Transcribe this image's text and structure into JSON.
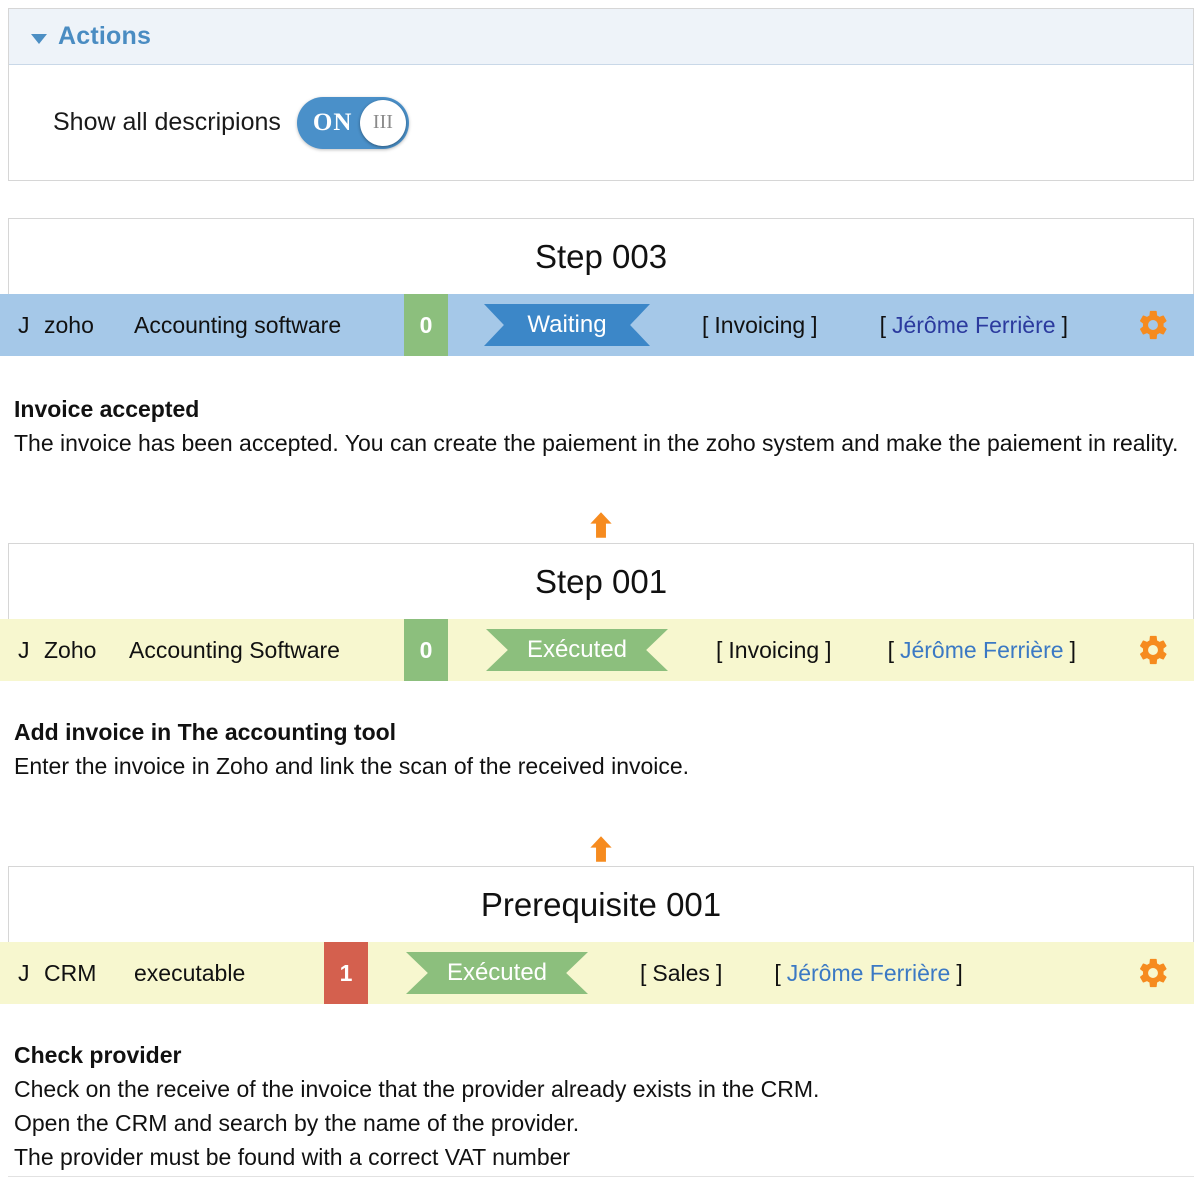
{
  "actions_panel": {
    "title": "Actions",
    "caret_icon": "caret-down-icon",
    "toggle": {
      "label": "Show all descripions",
      "state_text": "ON",
      "knob_glyph": "III"
    }
  },
  "colors": {
    "accent_blue": "#4a8cc2",
    "row_blue": "#a5c8e8",
    "row_yellow": "#f7f7cf",
    "badge_green": "#8cbf7d",
    "badge_red": "#d4604e",
    "ribbon_blue": "#3c87c8",
    "ribbon_green": "#8cbf7d",
    "gear_orange": "#f68b1f",
    "arrow_orange": "#f68b1f",
    "link_blue": "#3b79c4"
  },
  "steps": [
    {
      "title": "Step 003",
      "row_color": "blue",
      "initial": "J",
      "system": "zoho",
      "system_desc": "Accounting software",
      "count": "0",
      "count_color": "green",
      "status": "Waiting",
      "status_color": "blue",
      "tag_open": "[",
      "tag": "Invoicing",
      "tag_close": "]",
      "person_open": "[",
      "person": "Jérôme Ferrière",
      "person_close": "]",
      "gear_icon": "gear-icon",
      "desc_title": "Invoice accepted",
      "desc_lines": [
        "The invoice has been accepted. You can create the paiement in the zoho system and make the paiement in reality."
      ]
    },
    {
      "title": "Step 001",
      "row_color": "yellow",
      "initial": "J",
      "system": "Zoho",
      "system_desc": "Accounting Software",
      "count": "0",
      "count_color": "green",
      "status": "Exécuted",
      "status_color": "green",
      "tag_open": "[",
      "tag": "Invoicing",
      "tag_close": "]",
      "person_open": "[",
      "person": "Jérôme Ferrière",
      "person_close": "]",
      "gear_icon": "gear-icon",
      "desc_title": "Add invoice in The accounting tool",
      "desc_lines": [
        "Enter the invoice in Zoho and link the scan of the received invoice."
      ]
    },
    {
      "title": "Prerequisite 001",
      "row_color": "yellow",
      "initial": "J",
      "system": "CRM",
      "system_desc": "executable",
      "count": "1",
      "count_color": "red",
      "status": "Exécuted",
      "status_color": "green",
      "tag_open": "[",
      "tag": "Sales",
      "tag_close": "]",
      "person_open": "[",
      "person": "Jérôme Ferrière",
      "person_close": "]",
      "gear_icon": "gear-icon",
      "desc_title": "Check provider",
      "desc_lines": [
        "Check on the receive of the invoice that the provider already exists in the CRM.",
        "Open the CRM and search by the name of the provider.",
        "The provider must be found with a correct VAT number"
      ]
    }
  ],
  "connectors": [
    {
      "icon": "arrow-up-icon"
    },
    {
      "icon": "arrow-up-icon"
    }
  ]
}
